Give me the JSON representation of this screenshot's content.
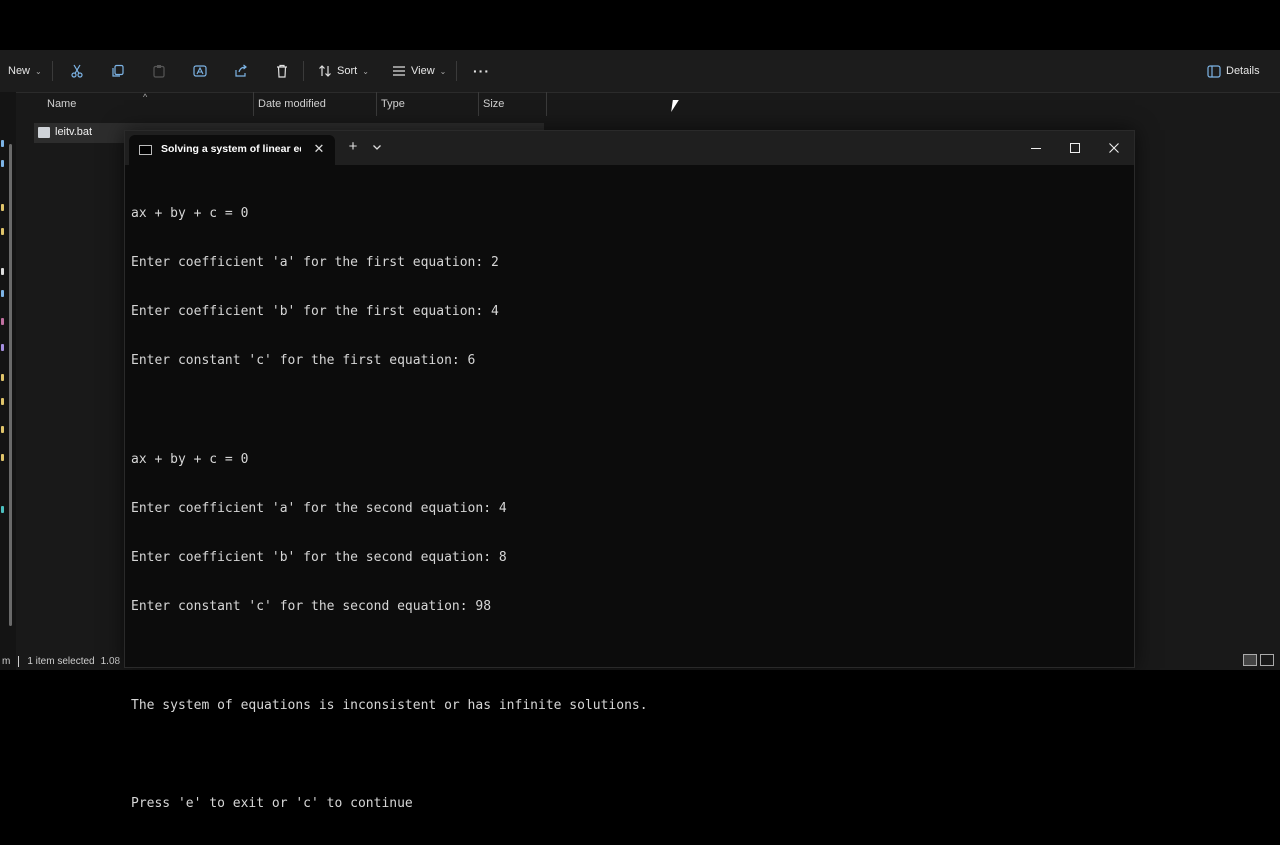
{
  "explorer": {
    "toolbar": {
      "new_label": "New",
      "sort_label": "Sort",
      "view_label": "View",
      "more_label": "···",
      "details_label": "Details"
    },
    "columns": {
      "name": "Name",
      "date_modified": "Date modified",
      "type": "Type",
      "size": "Size"
    },
    "file": {
      "name": "leitv.bat"
    },
    "status": {
      "left": "m",
      "selected": "1 item selected",
      "size": "1.08"
    }
  },
  "terminal": {
    "tab_title": "Solving a system of linear equ",
    "tab_close": "✕",
    "new_tab": "+",
    "lines": [
      "ax + by + c = 0",
      "Enter coefficient 'a' for the first equation: 2",
      "Enter coefficient 'b' for the first equation: 4",
      "Enter constant 'c' for the first equation: 6",
      "",
      "ax + by + c = 0",
      "Enter coefficient 'a' for the second equation: 4",
      "Enter coefficient 'b' for the second equation: 8",
      "Enter constant 'c' for the second equation: 98",
      "",
      "The system of equations is inconsistent or has infinite solutions.",
      "",
      "Press 'e' to exit or 'c' to continue"
    ]
  },
  "colors": {
    "explorer_bg": "#191919",
    "terminal_bg": "#0c0c0c",
    "terminal_text": "#d6d6d6",
    "titlebar_bg": "#1f1f1f"
  }
}
